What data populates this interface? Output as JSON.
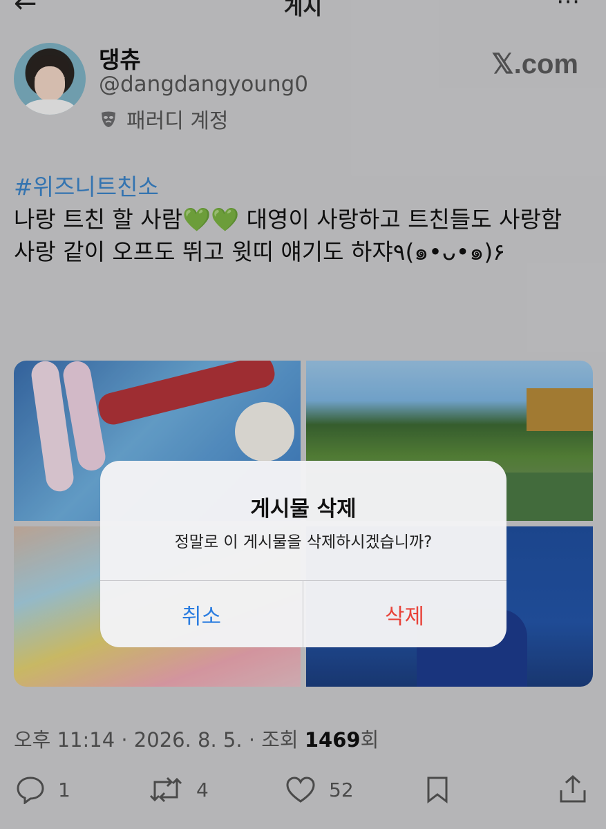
{
  "topbar": {
    "title": "게시",
    "back_glyph": "←",
    "more_glyph": "⋯"
  },
  "author": {
    "display_name": "댕츄",
    "handle": "@dangdangyoung0",
    "badge_text": "패러디 계정",
    "badge_icon": "mask-icon"
  },
  "watermark": "𝕏.com",
  "post": {
    "hashtag": "#위즈니트친소",
    "line1_a": "나랑 트친 할 사람",
    "line1_hearts": "💚💚",
    "line1_b": " 대영이 사랑하고 트친들도 사랑함",
    "line2": "사랑 같이 오프도 뛰고 윗띠 얘기도 하쟈٩(๑•ᴗ•๑)۶"
  },
  "meta": {
    "time_prefix": "오후 11:14 · 2026. 8. 5. · 조회 ",
    "views": "1469",
    "views_suffix": "회"
  },
  "actions": {
    "reply_count": "1",
    "repost_count": "4",
    "like_count": "52"
  },
  "alert": {
    "title": "게시물 삭제",
    "message": "정말로 이 게시물을 삭제하시겠습니까?",
    "cancel_label": "취소",
    "delete_label": "삭제"
  },
  "colors": {
    "link": "#3c84c9",
    "cancel": "#2b7de0",
    "destructive": "#e8433a"
  }
}
